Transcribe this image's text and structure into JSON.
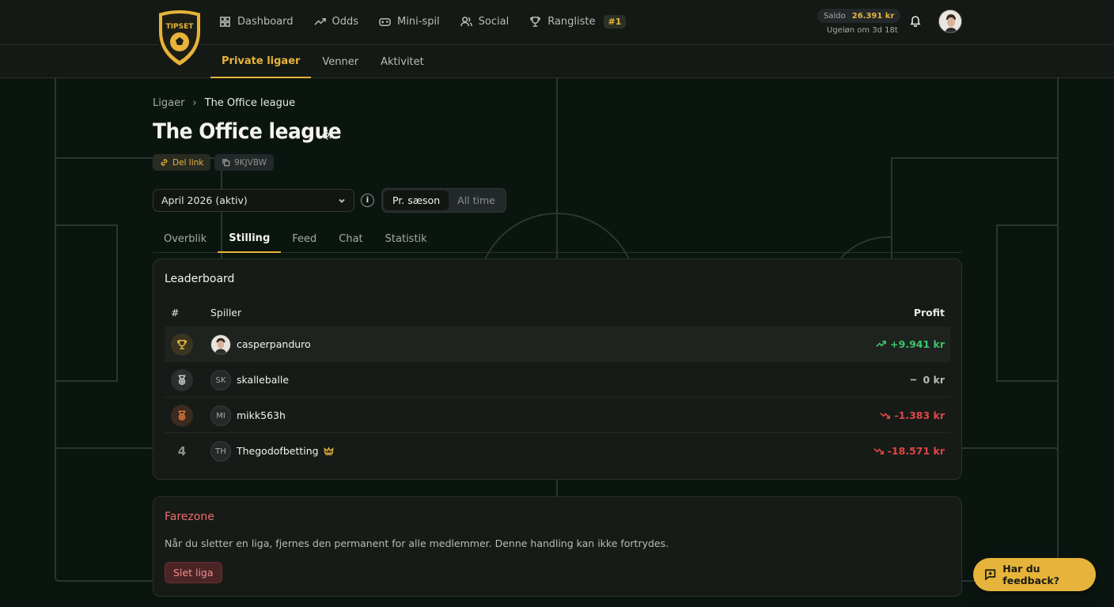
{
  "brand": {
    "logo_text": "TIPSET"
  },
  "nav": {
    "items": [
      {
        "label": "Dashboard",
        "icon": "dashboard-icon"
      },
      {
        "label": "Odds",
        "icon": "trend-icon"
      },
      {
        "label": "Mini-spil",
        "icon": "gamepad-icon"
      },
      {
        "label": "Social",
        "icon": "users-icon"
      },
      {
        "label": "Rangliste",
        "icon": "trophy-icon"
      }
    ],
    "rank_badge": "#1"
  },
  "account": {
    "saldo_label": "Saldo",
    "saldo_value": "26.391 kr",
    "ugelon": "Ugeløn om 3d 18t"
  },
  "subnav": {
    "items": [
      "Private ligaer",
      "Venner",
      "Aktivitet"
    ],
    "active": "Private ligaer"
  },
  "breadcrumb": {
    "root": "Ligaer",
    "current": "The Office league"
  },
  "league": {
    "title": "The Office league",
    "share_label": "Del link",
    "code": "9KJVBW"
  },
  "filters": {
    "period": "April 2026 (aktiv)",
    "info": "i",
    "toggle": [
      "Pr. sæson",
      "All time"
    ],
    "toggle_active": "Pr. sæson"
  },
  "tabs": {
    "items": [
      "Overblik",
      "Stilling",
      "Feed",
      "Chat",
      "Statistik"
    ],
    "active": "Stilling"
  },
  "leaderboard": {
    "title": "Leaderboard",
    "col_rank": "#",
    "col_player": "Spiller",
    "col_profit": "Profit",
    "rows": [
      {
        "rank": "1",
        "initials": "",
        "name": "casperpanduro",
        "profit": "+9.941 kr",
        "trend": "up"
      },
      {
        "rank": "2",
        "initials": "SK",
        "name": "skalleballe",
        "profit": "0 kr",
        "trend": "flat"
      },
      {
        "rank": "3",
        "initials": "MI",
        "name": "mikk563h",
        "profit": "-1.383 kr",
        "trend": "down"
      },
      {
        "rank": "4",
        "initials": "TH",
        "name": "Thegodofbetting",
        "profit": "-18.571 kr",
        "trend": "down",
        "crown": true
      }
    ]
  },
  "danger": {
    "title": "Farezone",
    "text": "Når du sletter en liga, fjernes den permanent for alle medlemmer. Denne handling kan ikke fortrydes.",
    "button": "Slet liga"
  },
  "feedback": {
    "label": "Har du feedback?"
  },
  "colors": {
    "accent": "#e6b43a",
    "positive": "#3cc56a",
    "negative": "#e04646",
    "danger": "#ee6b6b"
  }
}
